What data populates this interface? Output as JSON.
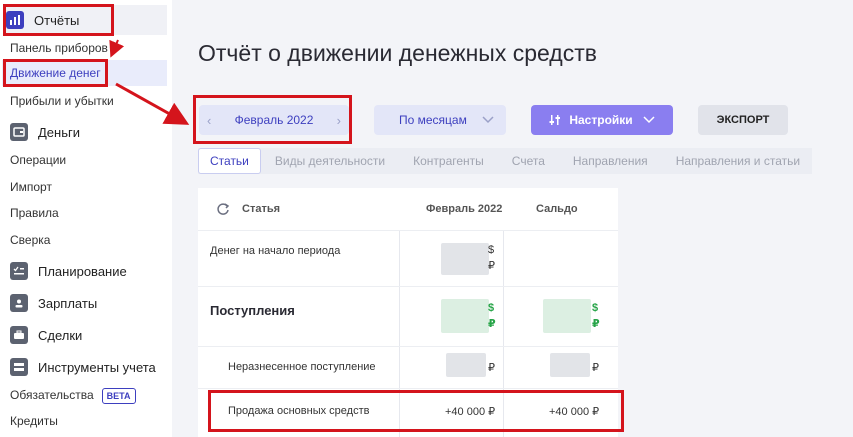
{
  "sidebar": {
    "sections": [
      {
        "label": "Отчёты",
        "icon": "bar-chart-icon"
      },
      {
        "label": "Деньги",
        "icon": "wallet-icon"
      },
      {
        "label": "Планирование",
        "icon": "checklist-icon"
      },
      {
        "label": "Зарплаты",
        "icon": "badge-icon"
      },
      {
        "label": "Сделки",
        "icon": "briefcase-icon"
      },
      {
        "label": "Инструменты учета",
        "icon": "tools-icon"
      }
    ],
    "reports_items": [
      "Панель приборов",
      "Движение денег",
      "Прибыли и убытки"
    ],
    "money_items": [
      "Операции",
      "Импорт",
      "Правила",
      "Сверка"
    ],
    "tools_items": [
      "Обязательства",
      "Кредиты"
    ],
    "beta": "BETA"
  },
  "page": {
    "title": "Отчёт о движении денежных средств"
  },
  "toolbar": {
    "period": "Февраль 2022",
    "group": "По месяцам",
    "settings": "Настройки",
    "export": "ЭКСПОРТ"
  },
  "tabs": [
    "Статьи",
    "Виды деятельности",
    "Контрагенты",
    "Счета",
    "Направления",
    "Направления и статьи"
  ],
  "table": {
    "headers": {
      "article": "Статья",
      "month": "Февраль 2022",
      "balance": "Сальдо"
    },
    "rows": [
      {
        "label": "Денег на начало периода",
        "month_tail_usd": "$",
        "month_tail_rub": "₽"
      },
      {
        "label": "Поступления",
        "month_tail_usd": "$",
        "month_tail_rub": "₽",
        "balance_tail_usd": "$",
        "balance_tail_rub": "₽"
      },
      {
        "label": "Неразнесенное поступление",
        "month_tail_rub": "₽",
        "balance_tail_rub": "₽"
      },
      {
        "label": "Продажа основных средств",
        "month": "+40 000 ₽",
        "balance": "+40 000 ₽"
      }
    ]
  },
  "colors": {
    "accent": "#3d3fbf",
    "settings_bg": "#8a7ef0",
    "annotation": "#d4141c",
    "positive": "#27a448"
  }
}
